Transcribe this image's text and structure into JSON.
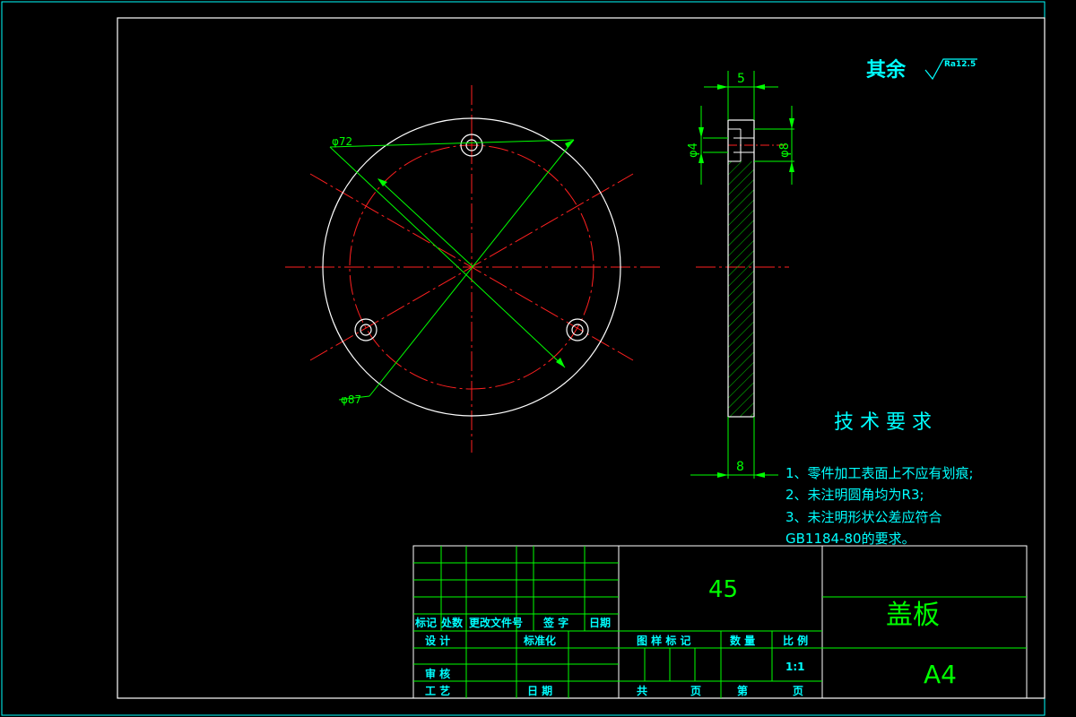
{
  "surface_finish": {
    "prefix": "其余",
    "roughness": "Ra12.5"
  },
  "front_view": {
    "outer_diameter_label": "φ87",
    "bolt_circle_label": "φ72"
  },
  "side_view": {
    "top_width_label": "5",
    "hole_label": "φ4",
    "counterbore_label": "φ8",
    "thickness_label": "8"
  },
  "tech_requirements": {
    "title": "技 术 要 求",
    "items": [
      "1、零件加工表面上不应有划痕;",
      "2、未注明圆角均为R3;",
      "3、未注明形状公差应符合",
      "GB1184-80的要求。"
    ]
  },
  "title_block": {
    "material": "45",
    "part_name": "盖板",
    "sheet_size": "A4",
    "scale": "1:1",
    "header_cells": [
      "标记",
      "处数",
      "更改文件号",
      "签 字",
      "日期"
    ],
    "design_label": "设 计",
    "standardize_label": "标准化",
    "review_label": "审 核",
    "process_label": "工 艺",
    "date_label": "日 期",
    "drawing_mark_label": "图 样 标 记",
    "quantity_label": "数 量",
    "ratio_label": "比 例",
    "total_label": "共",
    "sheet_label": "页",
    "page_label": "第",
    "page_label2": "页"
  }
}
